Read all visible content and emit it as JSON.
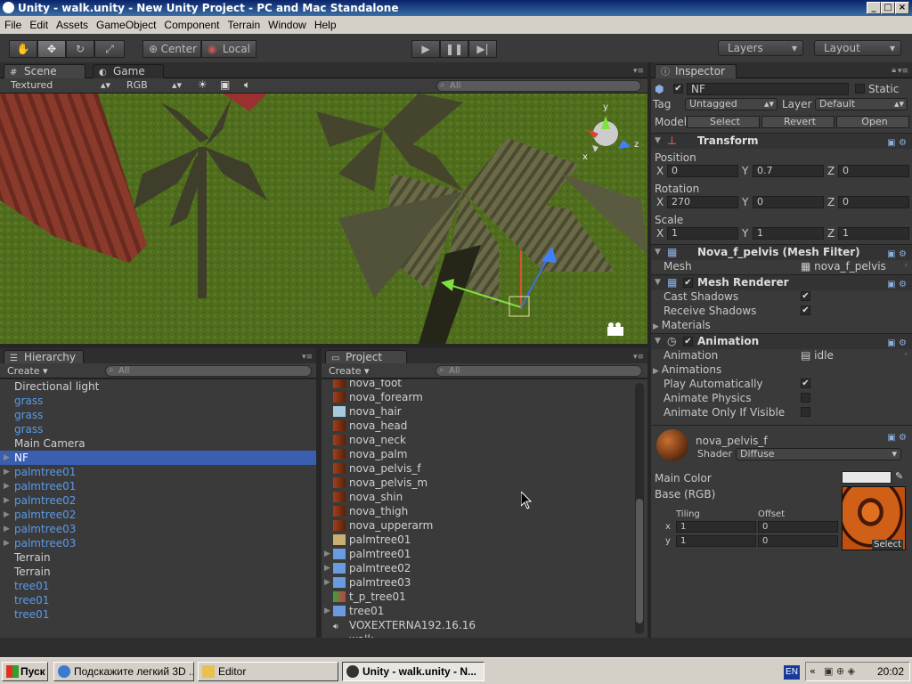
{
  "window": {
    "title": "Unity - walk.unity - New Unity Project - PC and Mac Standalone"
  },
  "menu": [
    "File",
    "Edit",
    "Assets",
    "GameObject",
    "Component",
    "Terrain",
    "Window",
    "Help"
  ],
  "toolbar": {
    "center_label": "Center",
    "local_label": "Local",
    "layers_label": "Layers",
    "layout_label": "Layout"
  },
  "scene": {
    "tabs": [
      "Scene",
      "Game"
    ],
    "render_mode": "Textured",
    "color_mode": "RGB",
    "search_placeholder": "All",
    "gizmo": {
      "y": "y",
      "x": "x",
      "z": "z"
    }
  },
  "hierarchy": {
    "tab": "Hierarchy",
    "create": "Create",
    "search_placeholder": "All",
    "items": [
      {
        "label": "Directional light",
        "prefab": false,
        "expand": false,
        "selected": false
      },
      {
        "label": "grass",
        "prefab": true,
        "expand": false,
        "selected": false
      },
      {
        "label": "grass",
        "prefab": true,
        "expand": false,
        "selected": false
      },
      {
        "label": "grass",
        "prefab": true,
        "expand": false,
        "selected": false
      },
      {
        "label": "Main Camera",
        "prefab": false,
        "expand": false,
        "selected": false
      },
      {
        "label": "NF",
        "prefab": false,
        "expand": true,
        "selected": true
      },
      {
        "label": "palmtree01",
        "prefab": true,
        "expand": true,
        "selected": false
      },
      {
        "label": "palmtree01",
        "prefab": true,
        "expand": true,
        "selected": false
      },
      {
        "label": "palmtree02",
        "prefab": true,
        "expand": true,
        "selected": false
      },
      {
        "label": "palmtree02",
        "prefab": true,
        "expand": true,
        "selected": false
      },
      {
        "label": "palmtree03",
        "prefab": true,
        "expand": true,
        "selected": false
      },
      {
        "label": "palmtree03",
        "prefab": true,
        "expand": true,
        "selected": false
      },
      {
        "label": "Terrain",
        "prefab": false,
        "expand": false,
        "selected": false
      },
      {
        "label": "Terrain",
        "prefab": false,
        "expand": false,
        "selected": false
      },
      {
        "label": "tree01",
        "prefab": true,
        "expand": false,
        "selected": false
      },
      {
        "label": "tree01",
        "prefab": true,
        "expand": false,
        "selected": false
      },
      {
        "label": "tree01",
        "prefab": true,
        "expand": false,
        "selected": false
      }
    ]
  },
  "project": {
    "tab": "Project",
    "create": "Create",
    "search_placeholder": "All",
    "items": [
      {
        "label": "nova_foot",
        "kind": "tex",
        "expand": false
      },
      {
        "label": "nova_forearm",
        "kind": "tex",
        "expand": false
      },
      {
        "label": "nova_hair",
        "kind": "hair",
        "expand": false
      },
      {
        "label": "nova_head",
        "kind": "tex",
        "expand": false
      },
      {
        "label": "nova_neck",
        "kind": "tex",
        "expand": false
      },
      {
        "label": "nova_palm",
        "kind": "tex",
        "expand": false
      },
      {
        "label": "nova_pelvis_f",
        "kind": "tex",
        "expand": false
      },
      {
        "label": "nova_pelvis_m",
        "kind": "tex",
        "expand": false
      },
      {
        "label": "nova_shin",
        "kind": "tex",
        "expand": false
      },
      {
        "label": "nova_thigh",
        "kind": "tex",
        "expand": false
      },
      {
        "label": "nova_upperarm",
        "kind": "tex",
        "expand": false
      },
      {
        "label": "palmtree01",
        "kind": "palm",
        "expand": false
      },
      {
        "label": "palmtree01",
        "kind": "prefab",
        "expand": true
      },
      {
        "label": "palmtree02",
        "kind": "prefab",
        "expand": true
      },
      {
        "label": "palmtree03",
        "kind": "prefab",
        "expand": true
      },
      {
        "label": "t_p_tree01",
        "kind": "tree",
        "expand": false
      },
      {
        "label": "tree01",
        "kind": "prefab",
        "expand": true
      },
      {
        "label": "VOXEXTERNA192.16.16",
        "kind": "audio",
        "expand": false
      },
      {
        "label": "walk",
        "kind": "scene",
        "expand": false
      }
    ]
  },
  "inspector": {
    "tab": "Inspector",
    "name": "NF",
    "static_label": "Static",
    "tag_label": "Tag",
    "tag_value": "Untagged",
    "layer_label": "Layer",
    "layer_value": "Default",
    "model_label": "Model",
    "select_btn": "Select",
    "revert_btn": "Revert",
    "open_btn": "Open",
    "transform": {
      "title": "Transform",
      "position_label": "Position",
      "position": {
        "x": "0",
        "y": "0.7",
        "z": "0"
      },
      "rotation_label": "Rotation",
      "rotation": {
        "x": "270",
        "y": "0",
        "z": "0"
      },
      "scale_label": "Scale",
      "scale": {
        "x": "1",
        "y": "1",
        "z": "1"
      },
      "axis_x": "X",
      "axis_y": "Y",
      "axis_z": "Z"
    },
    "mesh_filter": {
      "title": "Nova_f_pelvis (Mesh Filter)",
      "mesh_label": "Mesh",
      "mesh_value": "nova_f_pelvis"
    },
    "mesh_renderer": {
      "title": "Mesh Renderer",
      "cast_shadows": "Cast Shadows",
      "receive_shadows": "Receive Shadows",
      "materials": "Materials"
    },
    "animation": {
      "title": "Animation",
      "animation_label": "Animation",
      "animation_value": "idle",
      "animations": "Animations",
      "play_auto": "Play Automatically",
      "animate_physics": "Animate Physics",
      "animate_visible": "Animate Only If Visible"
    },
    "material": {
      "name": "nova_pelvis_f",
      "shader_label": "Shader",
      "shader_value": "Diffuse",
      "main_color": "Main Color",
      "base": "Base (RGB)",
      "tiling": "Tiling",
      "offset": "Offset",
      "tile_x": "1",
      "tile_y": "1",
      "off_x": "0",
      "off_y": "0",
      "x_lbl": "x",
      "y_lbl": "y",
      "select": "Select"
    }
  },
  "taskbar": {
    "start": "Пуск",
    "tasks": [
      "Подскажите легкий 3D ...",
      "Editor",
      "Unity - walk.unity - N..."
    ],
    "lang": "EN",
    "clock": "20:02"
  }
}
